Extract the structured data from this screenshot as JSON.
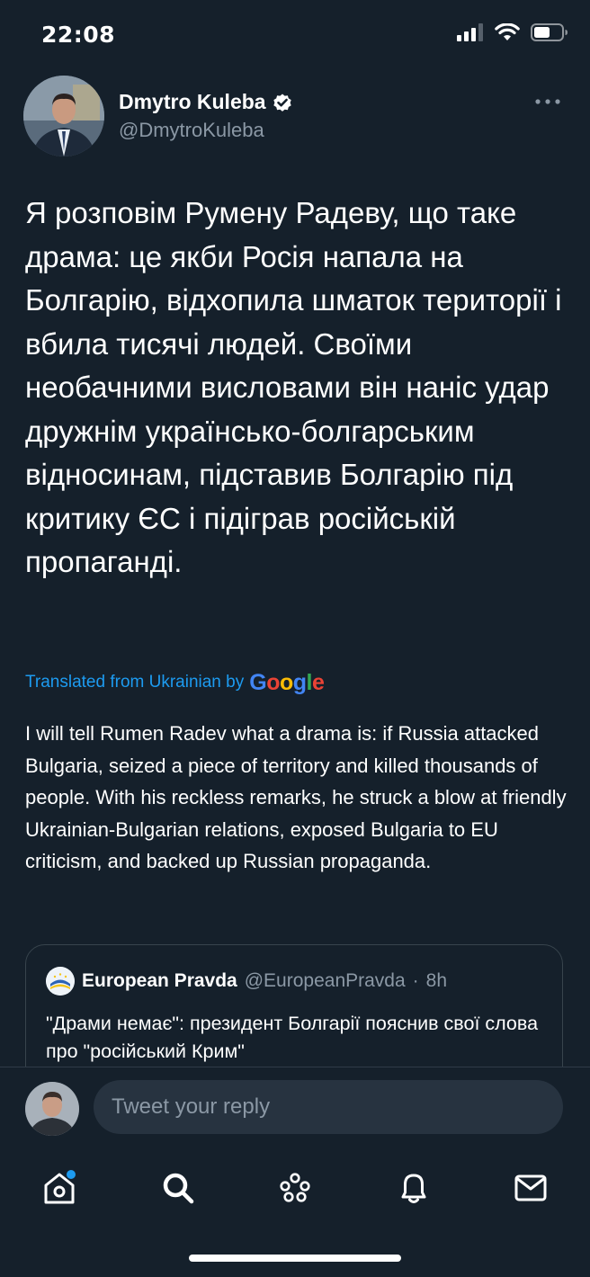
{
  "status_bar": {
    "time": "22:08",
    "signal_icon": "cellular-signal-icon",
    "wifi_icon": "wifi-icon",
    "battery_icon": "battery-icon"
  },
  "tweet": {
    "author_name": "Dmytro Kuleba",
    "verified_icon": "verified-badge-icon",
    "author_handle": "@DmytroKuleba",
    "more_icon": "more-options-icon",
    "text": "Я розповім Румену Радеву, що таке драма: це якби Росія напала на Болгарію, відхопила шматок території і вбила тисячі людей. Своїми необачними висловами він наніс удар дружнім українсько-болгарським відносинам, підставив Болгарію під критику ЄС і підіграв російській пропаганді.",
    "translated_from": "Translated from Ukrainian by",
    "google_logo": "Google",
    "translation": "I will tell Rumen Radev what a drama is: if Russia attacked Bulgaria, seized a piece of territory and killed thousands of people. With his reckless remarks, he struck a blow at friendly Ukrainian-Bulgarian relations, exposed Bulgaria to EU criticism, and backed up Russian propaganda."
  },
  "quote": {
    "name": "European Pravda",
    "handle": "@EuropeanPravda",
    "separator": "·",
    "time": "8h",
    "text": "\"Драми немає\": президент Болгарії пояснив свої слова про \"російський Крим\""
  },
  "reply": {
    "placeholder": "Tweet your reply"
  },
  "tabbar": {
    "items": [
      {
        "icon": "home-icon",
        "has_notification_dot": true
      },
      {
        "icon": "search-icon",
        "has_notification_dot": false
      },
      {
        "icon": "spaces-icon",
        "has_notification_dot": false
      },
      {
        "icon": "notifications-bell-icon",
        "has_notification_dot": false
      },
      {
        "icon": "messages-envelope-icon",
        "has_notification_dot": false
      }
    ]
  },
  "colors": {
    "background": "#15202b",
    "accent": "#1d9bf0",
    "secondary_text": "#8b98a5",
    "border": "#38444d"
  }
}
